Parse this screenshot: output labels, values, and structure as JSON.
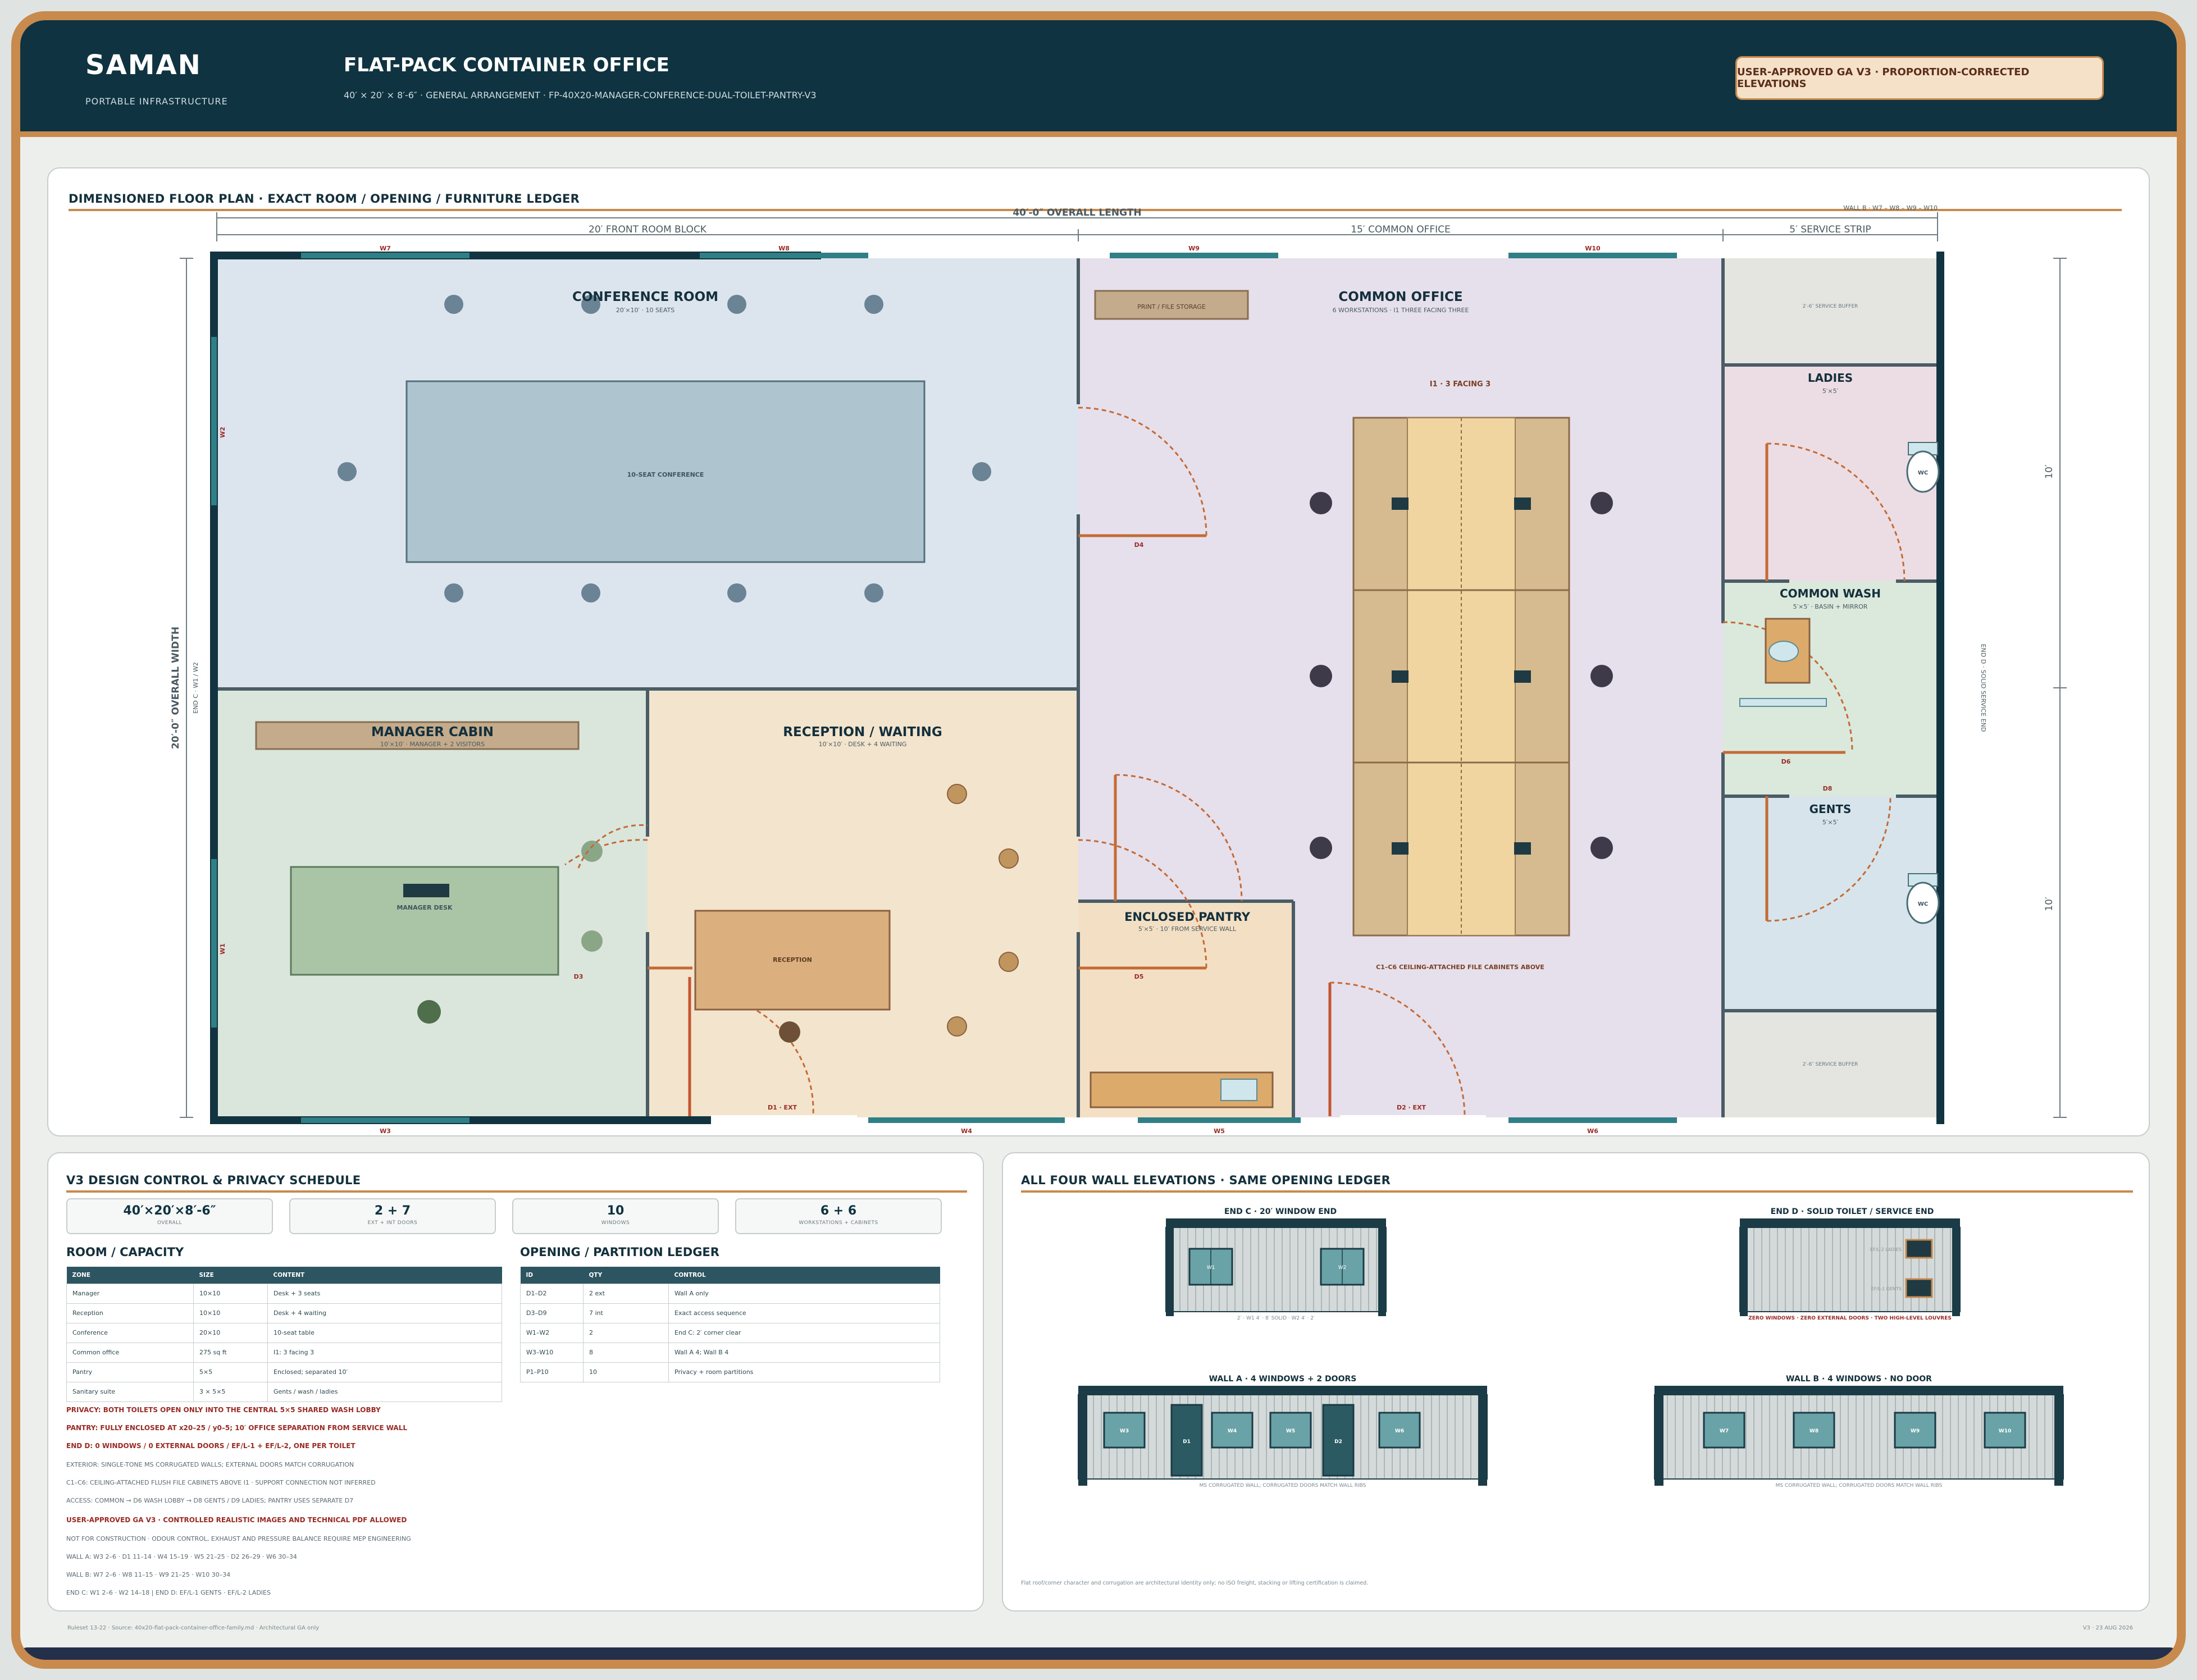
{
  "header": {
    "brand": "SAMAN",
    "brand_sub": "PORTABLE INFRASTRUCTURE",
    "title": "FLAT-PACK CONTAINER OFFICE",
    "subtitle": "40′ × 20′ × 8′-6″ · GENERAL ARRANGEMENT · FP-40X20-MANAGER-CONFERENCE-DUAL-TOILET-PANTRY-V3",
    "badge": "USER-APPROVED GA V3 · PROPORTION-CORRECTED ELEVATIONS"
  },
  "plan": {
    "title": "DIMENSIONED FLOOR PLAN · EXACT ROOM / OPENING / FURNITURE LEDGER",
    "overall_length": "40′-0″ OVERALL LENGTH",
    "wall_b_note": "WALL B · W7 – W8 – W9 – W10",
    "seg_front": "20′ FRONT ROOM BLOCK",
    "seg_common": "15′ COMMON OFFICE",
    "seg_service": "5′ SERVICE STRIP",
    "overall_width": "20′-0″ OVERALL WIDTH",
    "end_c": "END C · W1 / W2",
    "end_d": "END D · SOLID SERVICE END",
    "dim_right_top": "10′",
    "dim_right_bottom": "10′",
    "rooms": {
      "conference": {
        "name": "CONFERENCE ROOM",
        "sub": "20′×10′ · 10 SEATS",
        "table": "10-SEAT CONFERENCE"
      },
      "manager": {
        "name": "MANAGER CABIN",
        "sub": "10′×10′ · MANAGER + 2 VISITORS",
        "desk": "MANAGER DESK"
      },
      "reception": {
        "name": "RECEPTION / WAITING",
        "sub": "10′×10′ · DESK + 4 WAITING",
        "desk": "RECEPTION"
      },
      "common": {
        "name": "COMMON OFFICE",
        "sub": "6 WORKSTATIONS · I1 THREE FACING THREE",
        "label": "I1 · 3 FACING 3",
        "storage": "PRINT / FILE STORAGE",
        "cabinets": "C1–C6 CEILING-ATTACHED FILE CABINETS ABOVE"
      },
      "pantry": {
        "name": "ENCLOSED PANTRY",
        "sub": "5′×5′ · 10′ FROM SERVICE WALL"
      },
      "ladies": {
        "name": "LADIES",
        "sub": "5′×5′",
        "wc": "WC"
      },
      "wash": {
        "name": "COMMON WASH",
        "sub": "5′×5′ · BASIN + MIRROR"
      },
      "gents": {
        "name": "GENTS",
        "sub": "5′×5′",
        "wc": "WC"
      },
      "buffer_top": "2′-6″ SERVICE BUFFER",
      "buffer_bottom": "2′-6″ SERVICE BUFFER"
    },
    "openings": {
      "W1": "W1",
      "W2": "W2",
      "W3": "W3",
      "W4": "W4",
      "W5": "W5",
      "W6": "W6",
      "W7": "W7",
      "W8": "W8",
      "W9": "W9",
      "W10": "W10",
      "D1": "D1 · EXT",
      "D2": "D2 · EXT",
      "D3": "D3",
      "D4": "D4",
      "D5": "D5",
      "D6": "D6",
      "D8": "D8"
    }
  },
  "schedule": {
    "title": "V3 DESIGN CONTROL & PRIVACY SCHEDULE",
    "kpis": [
      {
        "value": "40′×20′×8′-6″",
        "label": "OVERALL"
      },
      {
        "value": "2 + 7",
        "label": "EXT + INT DOORS"
      },
      {
        "value": "10",
        "label": "WINDOWS"
      },
      {
        "value": "6 + 6",
        "label": "WORKSTATIONS + CABINETS"
      }
    ],
    "room_title": "ROOM / CAPACITY",
    "room_headers": [
      "ZONE",
      "SIZE",
      "CONTENT"
    ],
    "rooms": [
      [
        "Manager",
        "10×10",
        "Desk + 3 seats"
      ],
      [
        "Reception",
        "10×10",
        "Desk + 4 waiting"
      ],
      [
        "Conference",
        "20×10",
        "10-seat table"
      ],
      [
        "Common office",
        "275 sq ft",
        "I1: 3 facing 3"
      ],
      [
        "Pantry",
        "5×5",
        "Enclosed; separated 10′"
      ],
      [
        "Sanitary suite",
        "3 × 5×5",
        "Gents / wash / ladies"
      ]
    ],
    "open_title": "OPENING / PARTITION LEDGER",
    "open_headers": [
      "ID",
      "QTY",
      "CONTROL"
    ],
    "openings": [
      [
        "D1–D2",
        "2 ext",
        "Wall A only"
      ],
      [
        "D3–D9",
        "7 int",
        "Exact access sequence"
      ],
      [
        "W1–W2",
        "2",
        "End C: 2′ corner clear"
      ],
      [
        "W3–W10",
        "8",
        "Wall A 4; Wall B 4"
      ],
      [
        "P1–P10",
        "10",
        "Privacy + room partitions"
      ]
    ],
    "notes": [
      {
        "t": "PRIVACY: BOTH TOILETS OPEN ONLY INTO THE CENTRAL 5×5 SHARED WASH LOBBY",
        "red": true
      },
      {
        "t": "PANTRY: FULLY ENCLOSED AT x20–25 / y0–5; 10′ OFFICE SEPARATION FROM SERVICE WALL",
        "red": true
      },
      {
        "t": "END D: 0 WINDOWS / 0 EXTERNAL DOORS / EF/L-1 + EF/L-2, ONE PER TOILET",
        "red": true
      },
      {
        "t": "EXTERIOR: SINGLE-TONE MS CORRUGATED WALLS; EXTERNAL DOORS MATCH CORRUGATION",
        "red": false
      },
      {
        "t": "C1–C6: CEILING-ATTACHED FLUSH FILE CABINETS ABOVE I1 · SUPPORT CONNECTION NOT INFERRED",
        "red": false
      },
      {
        "t": "ACCESS: COMMON → D6 WASH LOBBY → D8 GENTS / D9 LADIES; PANTRY USES SEPARATE D7",
        "red": false
      },
      {
        "t": "USER-APPROVED GA V3 · CONTROLLED REALISTIC IMAGES AND TECHNICAL PDF ALLOWED",
        "red": true
      },
      {
        "t": "NOT FOR CONSTRUCTION · ODOUR CONTROL, EXHAUST AND PRESSURE BALANCE REQUIRE MEP ENGINEERING",
        "red": false
      },
      {
        "t": "WALL A: W3 2–6 · D1 11–14 · W4 15–19 · W5 21–25 · D2 26–29 · W6 30–34",
        "red": false
      },
      {
        "t": "WALL B: W7 2–6 · W8 11–15 · W9 21–25 · W10 30–34",
        "red": false
      },
      {
        "t": "END C: W1 2–6 · W2 14–18 | END D: EF/L-1 GENTS · EF/L-2 LADIES",
        "red": false
      }
    ]
  },
  "elevations": {
    "title": "ALL FOUR WALL ELEVATIONS · SAME OPENING LEDGER",
    "end_c": {
      "title": "END C · 20′ WINDOW END",
      "note": "2′ · W1 4′ · 8′ SOLID · W2 4′ · 2′",
      "w1": "W1",
      "w2": "W2"
    },
    "end_d": {
      "title": "END D · SOLID TOILET / SERVICE END",
      "note": "ZERO WINDOWS · ZERO EXTERNAL DOORS · TWO HIGH-LEVEL LOUVRES",
      "l1": "EF/L-2 LADIES",
      "l2": "EF/L-1 GENTS"
    },
    "wall_a": {
      "title": "WALL A · 4 WINDOWS + 2 DOORS",
      "note": "MS CORRUGATED WALL; CORRUGATED DOORS MATCH WALL RIBS",
      "items": [
        "W3",
        "D1",
        "W4",
        "W5",
        "D2",
        "W6"
      ]
    },
    "wall_b": {
      "title": "WALL B · 4 WINDOWS · NO DOOR",
      "note": "MS CORRUGATED WALL; CORRUGATED DOORS MATCH WALL RIBS",
      "items": [
        "W7",
        "W8",
        "W9",
        "W10"
      ]
    },
    "disclaimer": "Flat roof/corner character and corrugation are architectural identity only; no ISO freight, stacking or lifting certification is claimed."
  },
  "footer": {
    "left": "Ruleset 13-22 · Source: 40x20-flat-pack-container-office-family.md · Architectural GA only",
    "right": "V3 · 23 AUG 2026"
  }
}
